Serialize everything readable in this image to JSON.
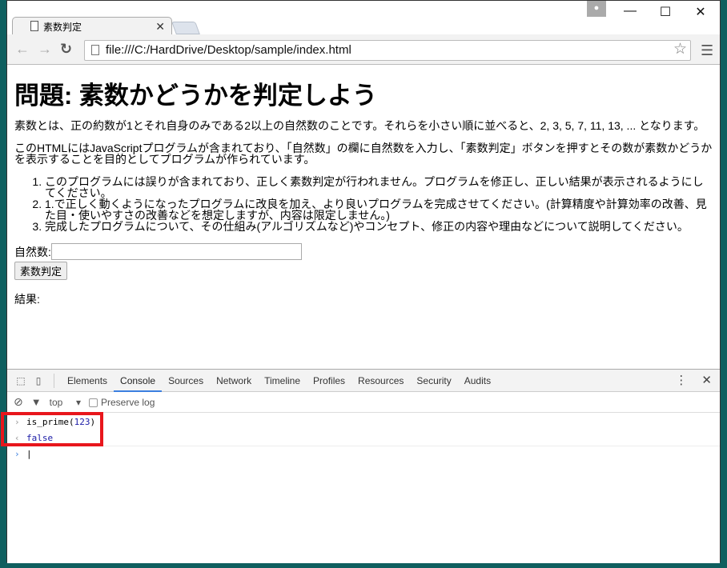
{
  "browser": {
    "tab_title": "素数判定",
    "url": "file:///C:/HardDrive/Desktop/sample/index.html"
  },
  "page": {
    "heading": "問題: 素数かどうかを判定しよう",
    "para1": "素数とは、正の約数が1とそれ自身のみである2以上の自然数のことです。それらを小さい順に並べると、2, 3, 5, 7, 11, 13, ... となります。",
    "para2": "このHTMLにはJavaScriptプログラムが含まれており、「自然数」の欄に自然数を入力し、「素数判定」ボタンを押すとその数が素数かどうかを表示することを目的としてプログラムが作られています。",
    "items": [
      "このプログラムには誤りが含まれており、正しく素数判定が行われません。プログラムを修正し、正しい結果が表示されるようにしてください。",
      "1.で正しく動くようになったプログラムに改良を加え、より良いプログラムを完成させてください。(計算精度や計算効率の改善、見た目・使いやすさの改善などを想定しますが、内容は限定しません。)",
      "完成したプログラムについて、その仕組み(アルゴリズムなど)やコンセプト、修正の内容や理由などについて説明してください。"
    ],
    "input_label": "自然数:",
    "input_value": "",
    "button_label": "素数判定",
    "result_label": "結果:"
  },
  "devtools": {
    "tabs": [
      "Elements",
      "Console",
      "Sources",
      "Network",
      "Timeline",
      "Profiles",
      "Resources",
      "Security",
      "Audits"
    ],
    "active_tab": "Console",
    "context": "top",
    "preserve_log": "Preserve log",
    "console": {
      "input_fn": "is_prime(",
      "input_arg": "123",
      "input_close": ")",
      "output": "false"
    },
    "highlight_color": "#e8161c"
  }
}
